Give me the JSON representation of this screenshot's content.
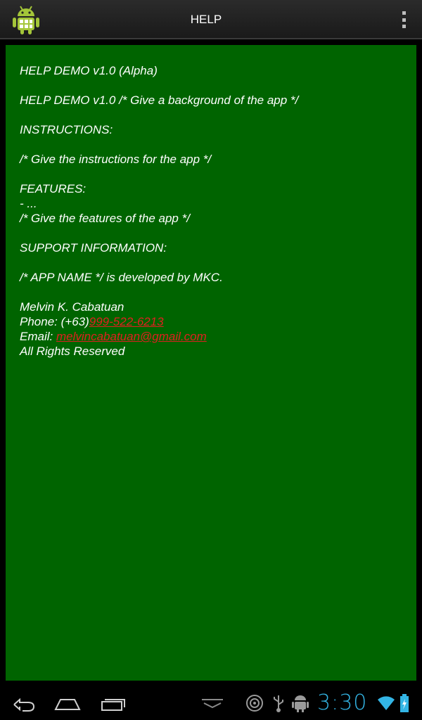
{
  "action_bar": {
    "title": "HELP",
    "app_icon": "android-robot-icon",
    "overflow_icon": "overflow-menu-icon"
  },
  "content": {
    "heading": "HELP DEMO v1.0 (Alpha)",
    "background_line": "HELP DEMO v1.0 /* Give a background of the app */",
    "instructions_header": "INSTRUCTIONS:",
    "instructions_text": "/* Give the instructions for the app */",
    "features_header": "FEATURES:",
    "features_bullet": "- ...",
    "features_text": "/* Give the features of the app */",
    "support_header": "SUPPORT INFORMATION:",
    "support_text": "/* APP NAME */ is developed by MKC.",
    "contact_name": "Melvin K. Cabatuan",
    "phone_label": "Phone: (+63)",
    "phone_number": "999-522-6213",
    "email_label": "Email: ",
    "email_address": "melvincabatuan@gmail.com",
    "rights": "All Rights Reserved"
  },
  "nav_bar": {
    "back_icon": "back-icon",
    "home_icon": "home-icon",
    "recents_icon": "recent-apps-icon",
    "keyboard_hide_icon": "chevron-down-icon",
    "clock": "3:30",
    "status_icons": [
      "gps-icon",
      "usb-icon",
      "android-debug-icon",
      "wifi-icon",
      "battery-icon"
    ]
  },
  "colors": {
    "panel_background": "#006400",
    "link": "#e02020",
    "clock": "#33b5e5"
  }
}
